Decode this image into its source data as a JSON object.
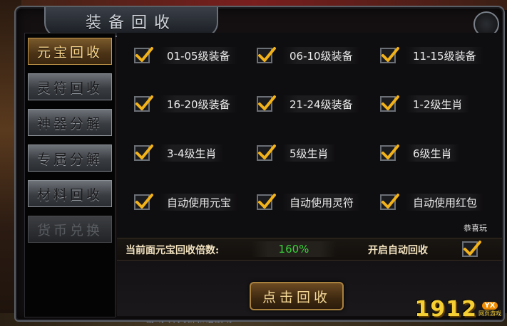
{
  "window": {
    "title": "装备回收"
  },
  "sidebar": {
    "items": [
      {
        "label": "元宝回收",
        "state": "active"
      },
      {
        "label": "灵符回收",
        "state": "normal"
      },
      {
        "label": "神器分解",
        "state": "normal"
      },
      {
        "label": "专属分解",
        "state": "normal"
      },
      {
        "label": "材料回收",
        "state": "normal"
      },
      {
        "label": "货币兑换",
        "state": "disabled"
      }
    ]
  },
  "options": [
    {
      "label": "01-05级装备",
      "checked": true
    },
    {
      "label": "06-10级装备",
      "checked": true
    },
    {
      "label": "11-15级装备",
      "checked": true
    },
    {
      "label": "16-20级装备",
      "checked": true
    },
    {
      "label": "21-24级装备",
      "checked": true
    },
    {
      "label": "1-2级生肖",
      "checked": true
    },
    {
      "label": "3-4级生肖",
      "checked": true
    },
    {
      "label": "5级生肖",
      "checked": true
    },
    {
      "label": "6级生肖",
      "checked": true
    },
    {
      "label": "自动使用元宝",
      "checked": true
    },
    {
      "label": "自动使用灵符",
      "checked": true
    },
    {
      "label": "自动使用红包",
      "checked": true
    }
  ],
  "message": "恭喜玩",
  "rate": {
    "label": "当前面元宝回收倍数:",
    "value": "160%"
  },
  "auto_recycle": {
    "label": "开启自动回收",
    "checked": true
  },
  "action": {
    "recycle_label": "点击回收"
  },
  "background": {
    "bottom_text": "游戏·开天新和谐战场"
  },
  "logo": {
    "number": "1912",
    "badge": "YX",
    "sub": "网页游戏"
  },
  "colors": {
    "accent_gold": "#f5d38a",
    "rate_green": "#38d23a",
    "check_gold": "#f2b21a"
  },
  "icons": {
    "checkbox": "gold-checkmark-icon",
    "corner": "ornament-icon"
  }
}
